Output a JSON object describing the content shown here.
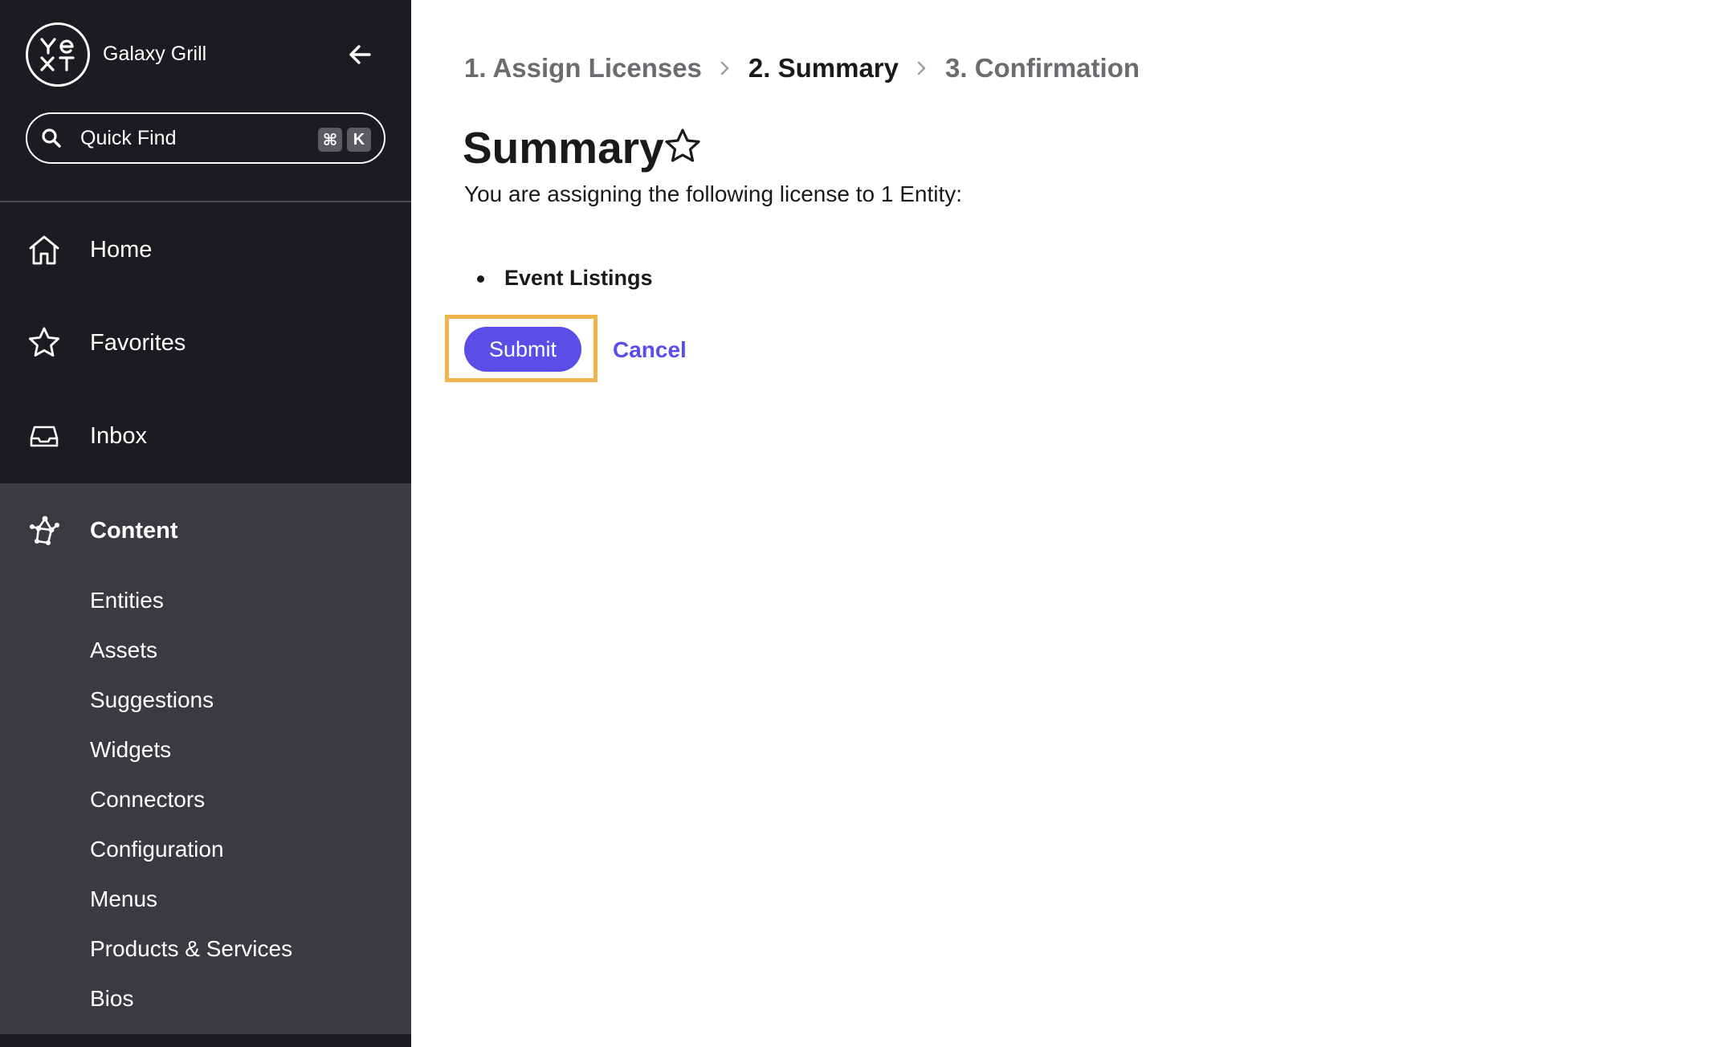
{
  "sidebar": {
    "logo_icon": "yext-logo-icon",
    "org_name": "Galaxy Grill",
    "collapse_icon": "arrow-left-icon",
    "quick_find": {
      "label": "Quick Find",
      "shortcut_cmd": "⌘",
      "shortcut_key": "K"
    },
    "nav": [
      {
        "label": "Home",
        "icon": "home-icon"
      },
      {
        "label": "Favorites",
        "icon": "star-icon"
      },
      {
        "label": "Inbox",
        "icon": "inbox-icon"
      }
    ],
    "content": {
      "label": "Content",
      "icon": "content-network-icon",
      "items": [
        {
          "label": "Entities"
        },
        {
          "label": "Assets"
        },
        {
          "label": "Suggestions"
        },
        {
          "label": "Widgets"
        },
        {
          "label": "Connectors"
        },
        {
          "label": "Configuration"
        },
        {
          "label": "Menus"
        },
        {
          "label": "Products & Services"
        },
        {
          "label": "Bios"
        }
      ]
    }
  },
  "main": {
    "breadcrumb": [
      {
        "label": "1. Assign Licenses",
        "active": false
      },
      {
        "label": "2. Summary",
        "active": true
      },
      {
        "label": "3. Confirmation",
        "active": false
      }
    ],
    "title": "Summary",
    "description": "You are assigning the following license to 1 Entity:",
    "licenses": [
      "Event Listings"
    ],
    "actions": {
      "submit_label": "Submit",
      "cancel_label": "Cancel"
    }
  },
  "colors": {
    "sidebar_bg": "#1c1c20",
    "sidebar_section_bg": "#3a3a40",
    "accent": "#5b4de8",
    "highlight": "#f0b44c"
  }
}
